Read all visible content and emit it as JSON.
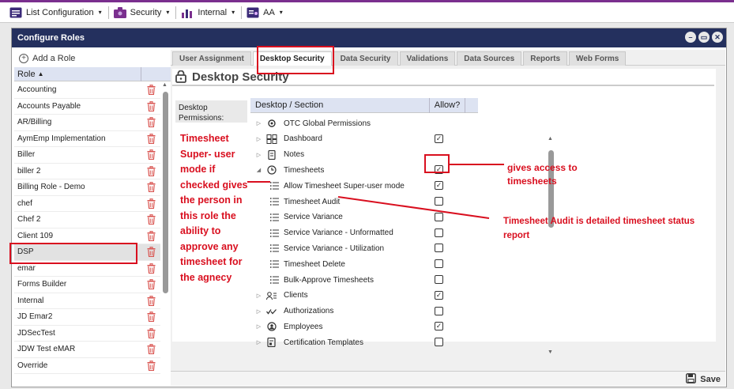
{
  "topbar": {
    "list_config": "List Configuration",
    "security": "Security",
    "internal": "Internal",
    "aa": "AA",
    "caret": "▾"
  },
  "dialog": {
    "title": "Configure Roles",
    "window_buttons": [
      "minimize-icon",
      "maximize-icon",
      "close-icon"
    ]
  },
  "left": {
    "add_role": "Add a Role",
    "column_header": "Role",
    "sort_indicator": "▲",
    "roles": [
      "Accounting",
      "Accounts Payable",
      "AR/Billing",
      "AymEmp Implementation",
      "Biller",
      "biller 2",
      "Billing Role - Demo",
      "chef",
      "Chef 2",
      "Client 109",
      "DSP",
      "emar",
      "Forms Builder",
      "Internal",
      "JD Emar2",
      "JDSecTest",
      "JDW Test eMAR",
      "Override"
    ],
    "selected_role": "DSP"
  },
  "tabs": [
    {
      "label": "User Assignment",
      "active": false
    },
    {
      "label": "Desktop Security",
      "active": true
    },
    {
      "label": "Data Security",
      "active": false
    },
    {
      "label": "Validations",
      "active": false
    },
    {
      "label": "Data Sources",
      "active": false
    },
    {
      "label": "Reports",
      "active": false
    },
    {
      "label": "Web Forms",
      "active": false
    }
  ],
  "panel": {
    "title": "Desktop Security",
    "permissions_label": "Desktop Permissions:",
    "col_section": "Desktop / Section",
    "col_allow": "Allow?"
  },
  "permissions": [
    {
      "label": "OTC Global Permissions",
      "icon": "gear-icon",
      "expander": "▷",
      "child": false,
      "checked": null
    },
    {
      "label": "Dashboard",
      "icon": "dashboard-icon",
      "expander": "▷",
      "child": false,
      "checked": true
    },
    {
      "label": "Notes",
      "icon": "notes-icon",
      "expander": "▷",
      "child": false,
      "checked": null
    },
    {
      "label": "Timesheets",
      "icon": "clock-icon",
      "expander": "◢",
      "child": false,
      "checked": true
    },
    {
      "label": "Allow Timesheet Super-user mode",
      "icon": "list-icon",
      "expander": "",
      "child": true,
      "checked": true
    },
    {
      "label": "Timesheet Audit",
      "icon": "list-icon",
      "expander": "",
      "child": true,
      "checked": false
    },
    {
      "label": "Service Variance",
      "icon": "list-icon",
      "expander": "",
      "child": true,
      "checked": false
    },
    {
      "label": "Service Variance - Unformatted",
      "icon": "list-icon",
      "expander": "",
      "child": true,
      "checked": false
    },
    {
      "label": "Service Variance - Utilization",
      "icon": "list-icon",
      "expander": "",
      "child": true,
      "checked": false
    },
    {
      "label": "Timesheet Delete",
      "icon": "list-icon",
      "expander": "",
      "child": true,
      "checked": false
    },
    {
      "label": "Bulk-Approve Timesheets",
      "icon": "list-icon",
      "expander": "",
      "child": true,
      "checked": false
    },
    {
      "label": "Clients",
      "icon": "clients-icon",
      "expander": "▷",
      "child": false,
      "checked": true
    },
    {
      "label": "Authorizations",
      "icon": "checks-icon",
      "expander": "▷",
      "child": false,
      "checked": false
    },
    {
      "label": "Employees",
      "icon": "employee-icon",
      "expander": "▷",
      "child": false,
      "checked": true
    },
    {
      "label": "Certification Templates",
      "icon": "template-icon",
      "expander": "▷",
      "child": false,
      "checked": false
    }
  ],
  "save_label": "Save",
  "annotations": {
    "super_user": "Timesheet Super- user mode if checked gives the person in this role the ability to approve any timesheet for the agnecy",
    "gives_access": "gives access to timesheets",
    "audit": "Timesheet Audit is detailed timesheet status report",
    "color": "#d90f1f"
  },
  "colors": {
    "titlebar": "#24305e",
    "header": "#dde3f2",
    "accent_purple": "#7a2f8e",
    "trash": "#d9534f"
  }
}
